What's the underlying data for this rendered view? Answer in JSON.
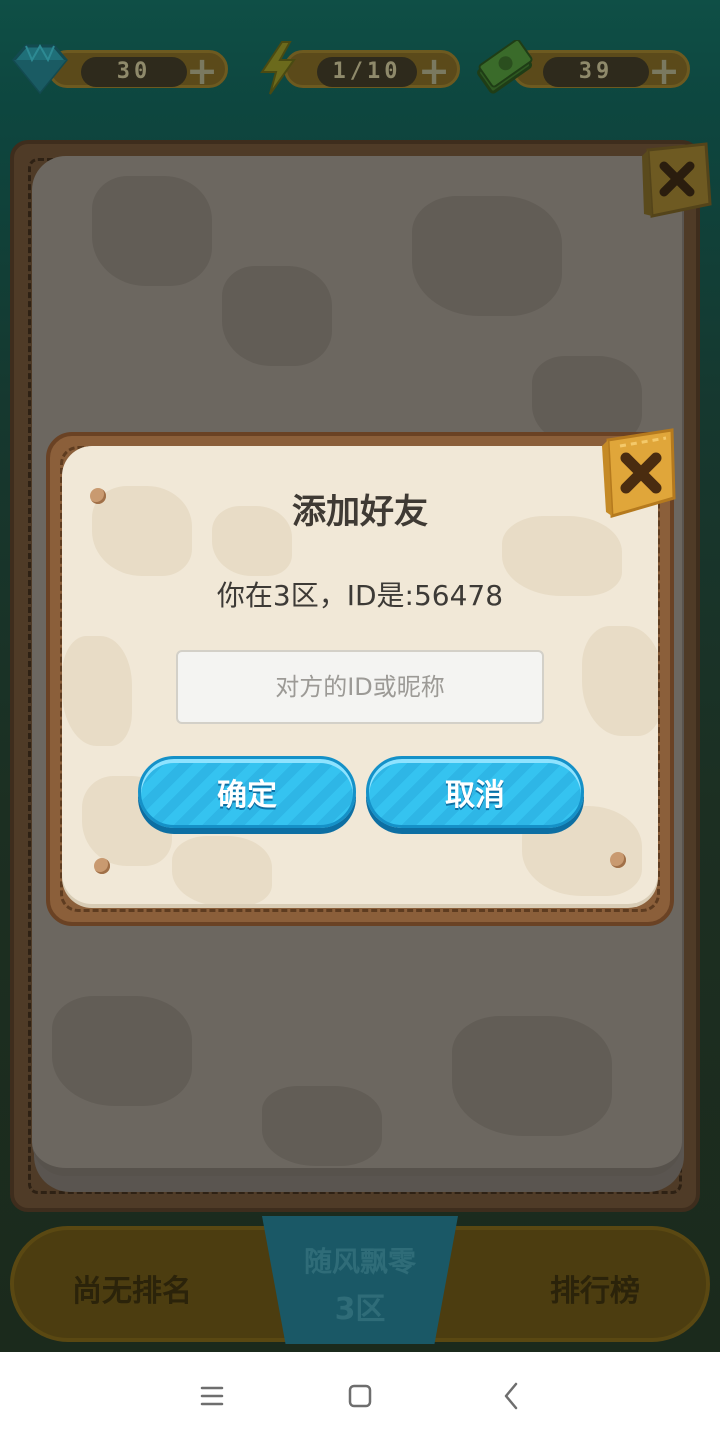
{
  "hud": {
    "gems": "30",
    "energy": "1/10",
    "cash": "39"
  },
  "dialog": {
    "title": "添加好友",
    "info": "你在3区，ID是:56478",
    "input_value": "",
    "input_placeholder": "对方的ID或昵称",
    "confirm_label": "确定",
    "cancel_label": "取消"
  },
  "bottom_bar": {
    "rank_text": "尚无排名",
    "player_name": "随风飘零",
    "zone_name": "3区",
    "leaderboard_label": "排行榜"
  },
  "colors": {
    "button_blue": "#35c3f0",
    "dialog_paper": "#f1e8d7",
    "dialog_frame": "#8b5f3a",
    "close_tag": "#e0a63a"
  },
  "icons": {
    "gems": "diamond-icon",
    "energy": "lightning-icon",
    "cash": "money-icon",
    "close": "close-icon",
    "nav_menu": "menu-icon",
    "nav_home": "home-square-icon",
    "nav_back": "back-chevron-icon"
  }
}
